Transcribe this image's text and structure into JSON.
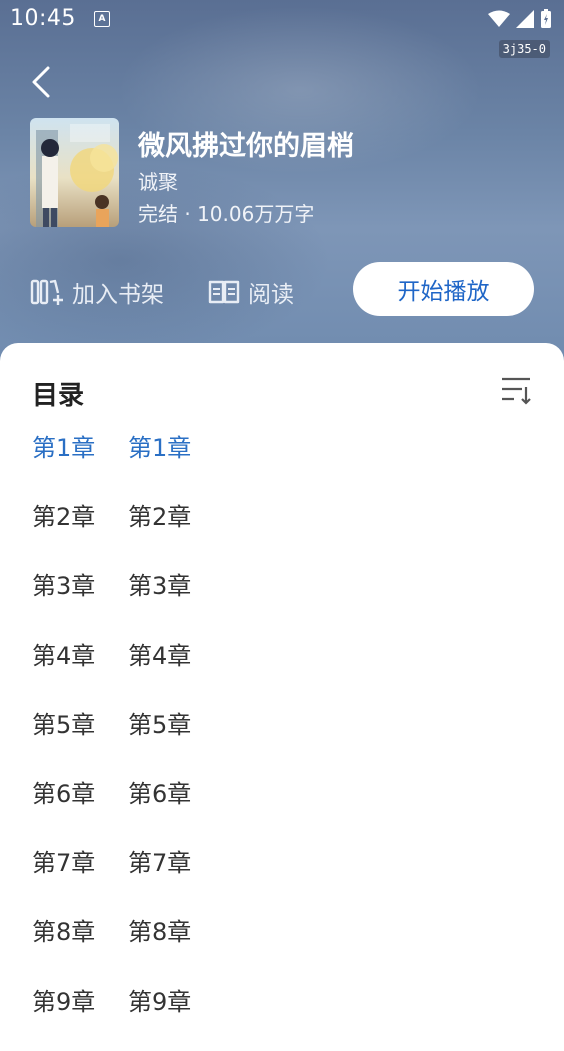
{
  "status_bar": {
    "time": "10:45",
    "notification_icon": "A",
    "version_tag": "3j35-0"
  },
  "book": {
    "title": "微风拂过你的眉梢",
    "author": "诚聚",
    "meta": "完结 · 10.06万万字"
  },
  "actions": {
    "shelf_label": "加入书架",
    "read_label": "阅读",
    "play_label": "开始播放"
  },
  "toc": {
    "title": "目录",
    "chapters": [
      {
        "num": "第1章",
        "name": "第1章"
      },
      {
        "num": "第2章",
        "name": "第2章"
      },
      {
        "num": "第3章",
        "name": "第3章"
      },
      {
        "num": "第4章",
        "name": "第4章"
      },
      {
        "num": "第5章",
        "name": "第5章"
      },
      {
        "num": "第6章",
        "name": "第6章"
      },
      {
        "num": "第7章",
        "name": "第7章"
      },
      {
        "num": "第8章",
        "name": "第8章"
      },
      {
        "num": "第9章",
        "name": "第9章"
      }
    ]
  },
  "colors": {
    "accent": "#2a6fc4",
    "hero_bg": "#6b84a6"
  }
}
